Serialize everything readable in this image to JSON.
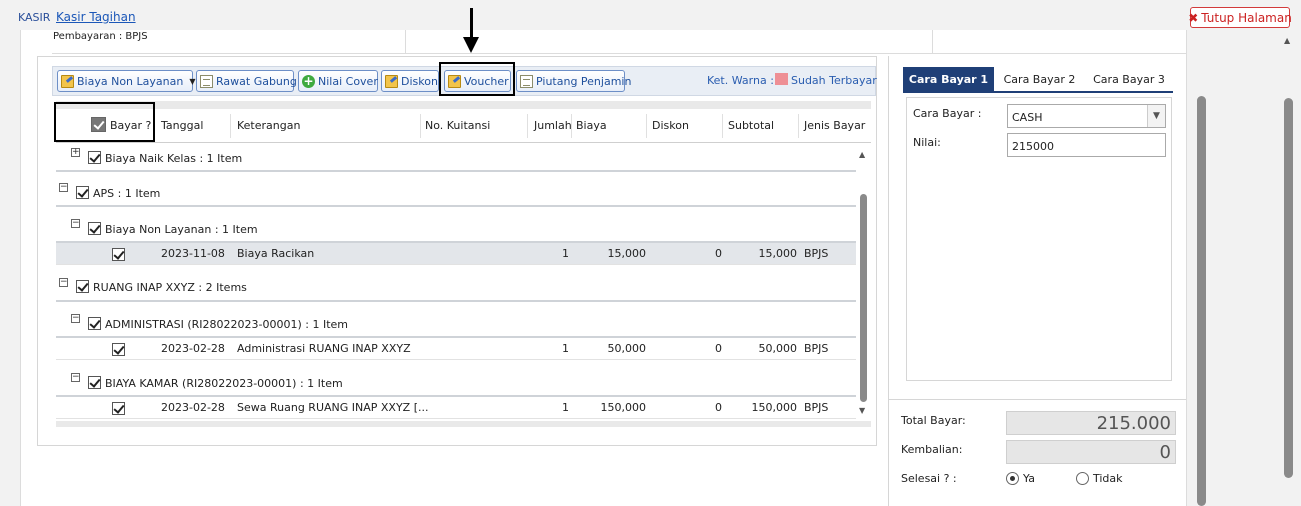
{
  "breadcrumb": {
    "root": "KASIR",
    "current": "Kasir Tagihan"
  },
  "close_button": {
    "label": "Tutup Halaman"
  },
  "info": {
    "payment": "Pembayaran : BPJS"
  },
  "toolbar": {
    "buttons": [
      {
        "label": "Biaya Non Layanan",
        "icon": "edit-icon"
      },
      {
        "label": "Rawat Gabung",
        "icon": "sheet-icon"
      },
      {
        "label": "Nilai Cover",
        "icon": "plus-icon"
      },
      {
        "label": "Diskon",
        "icon": "edit-icon"
      },
      {
        "label": "Voucher",
        "icon": "edit-icon"
      },
      {
        "label": "Piutang Penjamin",
        "icon": "sheet-icon"
      }
    ],
    "legend_label": "Ket. Warna :",
    "legend_text": "Sudah Terbayar",
    "legend_color": "#ee8f95"
  },
  "grid": {
    "columns": [
      "Bayar ?",
      "Tanggal",
      "Keterangan",
      "No. Kuitansi",
      "Jumlah",
      "Biaya",
      "Diskon",
      "Subtotal",
      "Jenis Bayar"
    ],
    "rows": [
      {
        "kind": "group",
        "level": 1,
        "toggle": "+",
        "label": "Biaya Naik Kelas : 1 Item"
      },
      {
        "kind": "group",
        "level": 0,
        "toggle": "−",
        "label": "APS : 1 Item"
      },
      {
        "kind": "group",
        "level": 1,
        "toggle": "−",
        "label": "Biaya Non Layanan : 1 Item"
      },
      {
        "kind": "data",
        "highlight": true,
        "tanggal": "2023-11-08",
        "keterangan": "Biaya Racikan",
        "kuitansi": "",
        "jumlah": "1",
        "biaya": "15,000",
        "diskon": "0",
        "subtotal": "15,000",
        "jenis": "BPJS"
      },
      {
        "kind": "group",
        "level": 0,
        "toggle": "−",
        "label": "RUANG INAP XXYZ : 2 Items"
      },
      {
        "kind": "group",
        "level": 1,
        "toggle": "−",
        "label": "ADMINISTRASI (RI28022023-00001) : 1 Item"
      },
      {
        "kind": "data",
        "highlight": false,
        "tanggal": "2023-02-28",
        "keterangan": "Administrasi RUANG INAP XXYZ",
        "kuitansi": "",
        "jumlah": "1",
        "biaya": "50,000",
        "diskon": "0",
        "subtotal": "50,000",
        "jenis": "BPJS"
      },
      {
        "kind": "group",
        "level": 1,
        "toggle": "−",
        "label": "BIAYA KAMAR (RI28022023-00001) : 1 Item"
      },
      {
        "kind": "data",
        "highlight": false,
        "tanggal": "2023-02-28",
        "keterangan": "Sewa Ruang RUANG INAP XXYZ [...",
        "kuitansi": "",
        "jumlah": "1",
        "biaya": "150,000",
        "diskon": "0",
        "subtotal": "150,000",
        "jenis": "BPJS"
      }
    ]
  },
  "payment": {
    "tabs": [
      "Cara Bayar 1",
      "Cara Bayar 2",
      "Cara Bayar 3"
    ],
    "active_tab": 0,
    "method_label": "Cara Bayar :",
    "method_value": "CASH",
    "amount_label": "Nilai:",
    "amount_value": "215000",
    "total_label": "Total Bayar:",
    "total_value": "215.000",
    "change_label": "Kembalian:",
    "change_value": "0",
    "done_label": "Selesai ? :",
    "done_options": [
      "Ya",
      "Tidak"
    ],
    "done_selected": "Ya"
  },
  "colors": {
    "accent": "#1f3f77",
    "link": "#1b57b8",
    "danger": "#cc2222"
  }
}
